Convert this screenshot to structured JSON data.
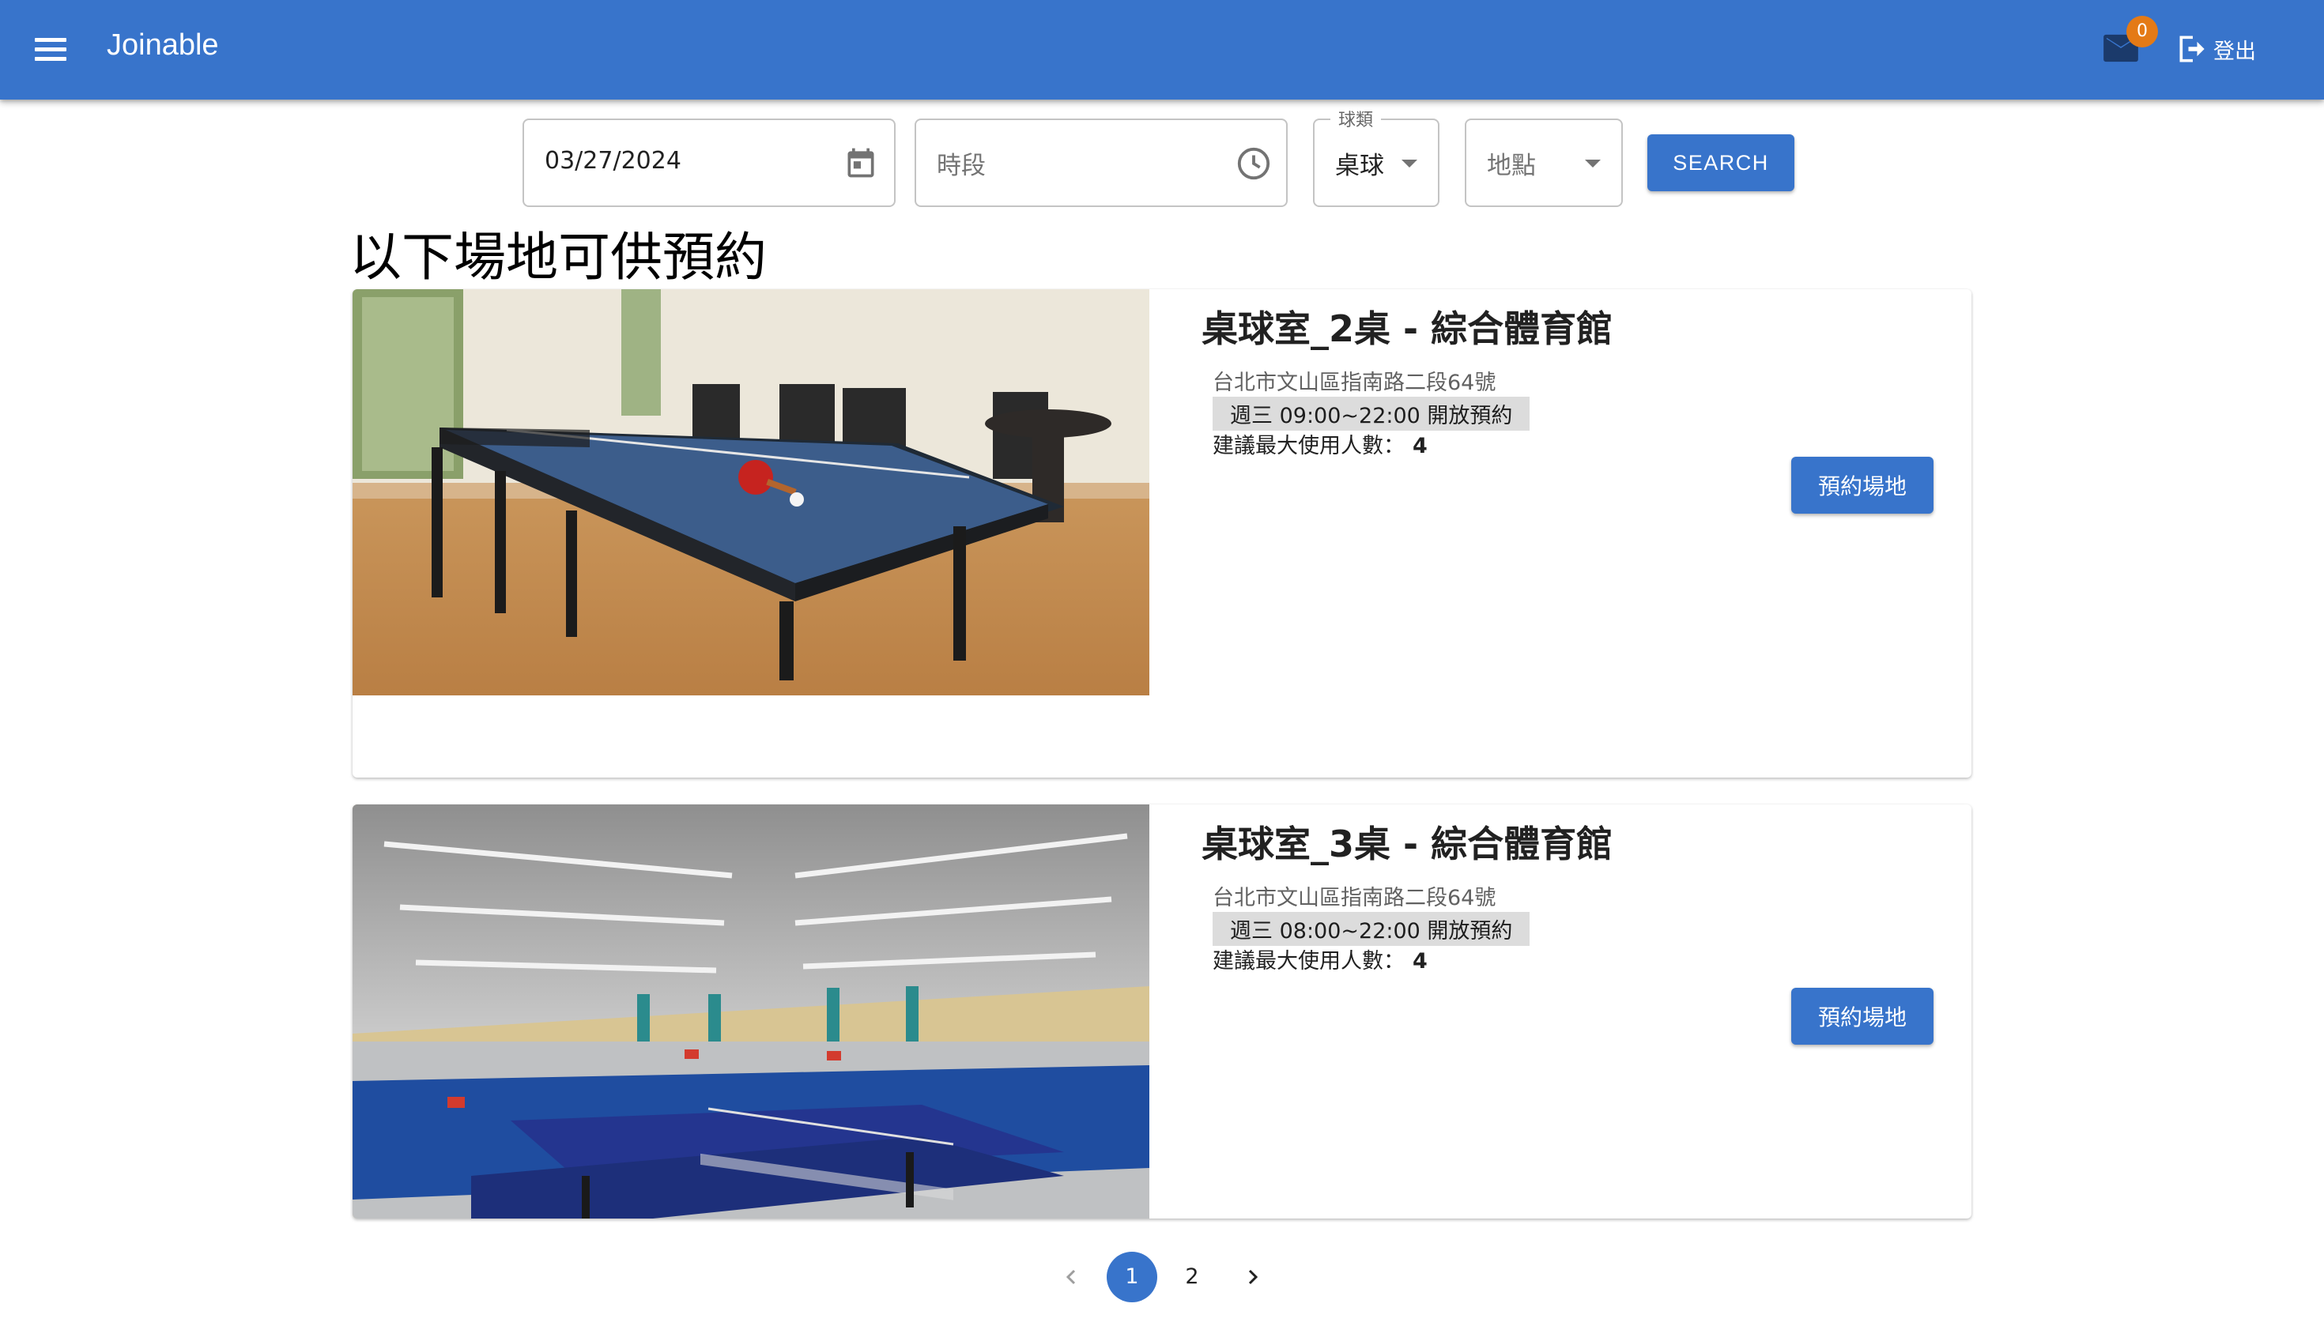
{
  "app": {
    "title": "Joinable"
  },
  "header": {
    "mail_badge": "0",
    "logout_label": "登出"
  },
  "search": {
    "date_value": "03/27/2024",
    "time_placeholder": "時段",
    "sport_label": "球類",
    "sport_value": "桌球",
    "location_placeholder": "地點",
    "button_label": "SEARCH"
  },
  "main": {
    "heading": "以下場地可供預約",
    "venues": [
      {
        "title": "桌球室_2桌 - 綜合體育館",
        "address": "台北市文山區指南路二段64號",
        "hours": "週三 09:00~22:00 開放預約",
        "capacity_label": "建議最大使用人數：",
        "capacity_value": "4",
        "button_label": "預約場地"
      },
      {
        "title": "桌球室_3桌 - 綜合體育館",
        "address": "台北市文山區指南路二段64號",
        "hours": "週三 08:00~22:00 開放預約",
        "capacity_label": "建議最大使用人數：",
        "capacity_value": "4",
        "button_label": "預約場地"
      }
    ]
  },
  "pagination": {
    "pages": [
      "1",
      "2"
    ],
    "current": "1"
  },
  "colors": {
    "primary": "#3874cb",
    "badge": "#e47a16"
  }
}
